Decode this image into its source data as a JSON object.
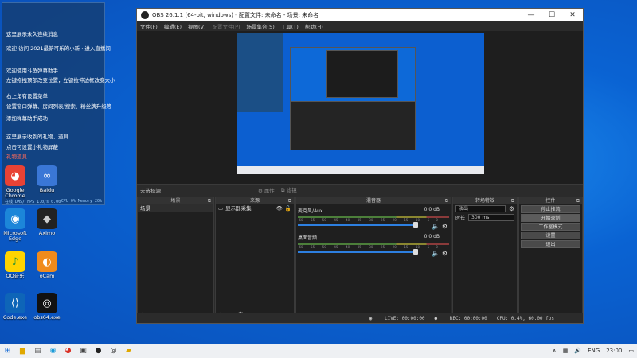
{
  "desktop": {
    "overlay_messages": [
      {
        "text": "这里展示永久连续消息",
        "red": false
      },
      {
        "text": "欢迎 访问 2021最新可乐的小新 · 进入直播间",
        "red": false
      },
      {
        "text": "欢迎使用斗鱼弹幕助手",
        "red": false
      },
      {
        "text": "左键拖拽顶部改变位置，左键拉伸边框改变大小",
        "red": false
      },
      {
        "text": "右上角有设置菜单",
        "red": false
      },
      {
        "text": "设置窗口弹幕、房间列表/搜索、粉丝牌升级等",
        "red": false
      },
      {
        "text": "添加弹幕助手成功",
        "red": false
      },
      {
        "text": "这里展示收到的礼物、道具",
        "red": false
      },
      {
        "text": "点击可设置小礼物屏蔽",
        "red": false
      },
      {
        "text": "礼物道具",
        "red": true
      }
    ],
    "overlay_status": [
      "在线 DMS/ FPS 1.0/s 0.00",
      "CPU 0% Memory 20%"
    ],
    "icons": [
      {
        "label": "Google Chrome",
        "name": "chrome-desktop-icon"
      },
      {
        "label": "Baidu",
        "name": "baidu-desktop-icon"
      },
      {
        "label": "Microsoft Edge",
        "name": "edge-desktop-icon"
      },
      {
        "label": "Aximo",
        "name": "aximo-desktop-icon"
      },
      {
        "label": "QQ音乐",
        "name": "qqmusic-desktop-icon"
      },
      {
        "label": "oCam",
        "name": "ocam-desktop-icon"
      },
      {
        "label": "Code.exe",
        "name": "vscode-desktop-icon"
      },
      {
        "label": "obs64.exe",
        "name": "obs-desktop-icon"
      }
    ]
  },
  "obs": {
    "title": "OBS 26.1.1 (64-bit, windows) - 配置文件: 未命名 - 场景: 未命名",
    "menu": [
      "文件(F)",
      "编辑(E)",
      "视图(V)",
      "配置文件(P)",
      "场景集合(S)",
      "工具(T)",
      "帮助(H)"
    ],
    "no_source_selected": "未选择源",
    "properties_label": "属性",
    "filters_label": "滤镜",
    "docks": {
      "scenes": {
        "title": "场景",
        "items": [
          "场景"
        ]
      },
      "sources": {
        "title": "来源",
        "items": [
          "显示器采集"
        ]
      },
      "mixer": {
        "title": "混音器",
        "ticks": [
          "-60",
          "-55",
          "-50",
          "-45",
          "-40",
          "-35",
          "-30",
          "-25",
          "-20",
          "-15",
          "-10",
          "-5",
          "0"
        ],
        "channels": [
          {
            "name": "麦克风/Aux",
            "db": "0.0 dB"
          },
          {
            "name": "桌面音频",
            "db": "0.0 dB"
          }
        ]
      },
      "transitions": {
        "title": "转场特效",
        "type": "淡出",
        "duration_label": "时长",
        "duration_value": "300 ms"
      },
      "controls": {
        "title": "控件",
        "buttons": [
          "停止推流",
          "开始录制",
          "工作室模式",
          "设置",
          "退出"
        ]
      }
    },
    "status": {
      "live": "LIVE: 00:00:00",
      "rec": "REC: 00:00:00",
      "cpu": "CPU: 0.4%, 60.00 fps"
    }
  },
  "taskbar": {
    "lang": "ENG",
    "time": "23:00"
  }
}
